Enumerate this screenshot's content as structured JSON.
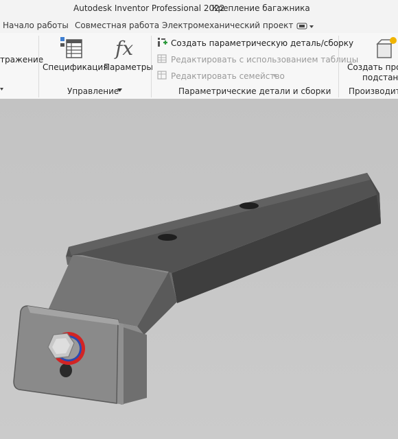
{
  "window": {
    "app_title": "Autodesk Inventor Professional 2022",
    "document_title": "Крепление багажника"
  },
  "tabs": [
    {
      "label": "Начало работы"
    },
    {
      "label": "Совместная работа"
    },
    {
      "label": "Электромеханический проект"
    }
  ],
  "ribbon": {
    "partial_left_label": "тражение",
    "manage_panel": {
      "title": "Управление",
      "buttons": [
        {
          "label": "Спецификация",
          "icon": "bom-table-icon"
        },
        {
          "label": "Параметры",
          "icon": "fx-parameters-icon"
        }
      ]
    },
    "parametric_panel": {
      "title": "Параметрические детали и сборки",
      "items": [
        {
          "label": "Создать параметрическую деталь/сборку",
          "enabled": true,
          "icon": "create-parametric-icon"
        },
        {
          "label": "Редактировать с использованием таблицы",
          "enabled": false,
          "icon": "edit-table-icon"
        },
        {
          "label": "Редактировать семейство",
          "enabled": false,
          "icon": "edit-family-icon"
        }
      ]
    },
    "productivity_panel": {
      "title": "Производите",
      "button_line1": "Создать прои",
      "button_line2": "подстанс",
      "icon": "create-substitute-icon"
    }
  },
  "colors": {
    "accent_green": "#2e9a3e",
    "bolt_ring_red": "#d22424",
    "bolt_ring_blue": "#2b4bb0",
    "part_dark": "#4d4d4d"
  }
}
